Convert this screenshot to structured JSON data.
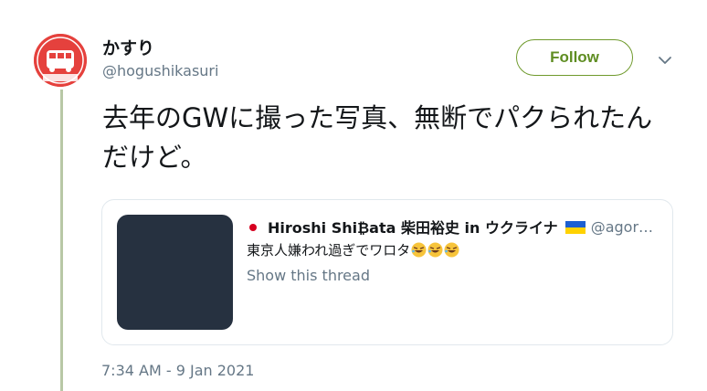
{
  "tweet": {
    "author": {
      "display_name": "かすり",
      "handle": "@hogushikasuri",
      "avatar_text": "バスのりば 専用バス"
    },
    "follow_label": "Follow",
    "text": "去年のGWに撮った写真、無断でパクられたんだけど。",
    "timestamp": "7:34 AM - 9 Jan 2021"
  },
  "quoted": {
    "flag_left": "japan-flag",
    "name": "Hiroshi Shi₿ata 柴田裕史 in ウクライナ",
    "flag_right": "ukraine-flag",
    "handle": "@agor…",
    "text": "東京人嫌われ過ぎでワロタ",
    "emoji": "rolling-on-floor-laughing",
    "show_thread": "Show this thread"
  },
  "icons": {
    "more": "chevron-down-icon"
  },
  "colors": {
    "follow_accent": "#5f8d22",
    "thread_line": "#b8c8a6",
    "secondary_text": "#657786",
    "media_placeholder": "#263140"
  }
}
